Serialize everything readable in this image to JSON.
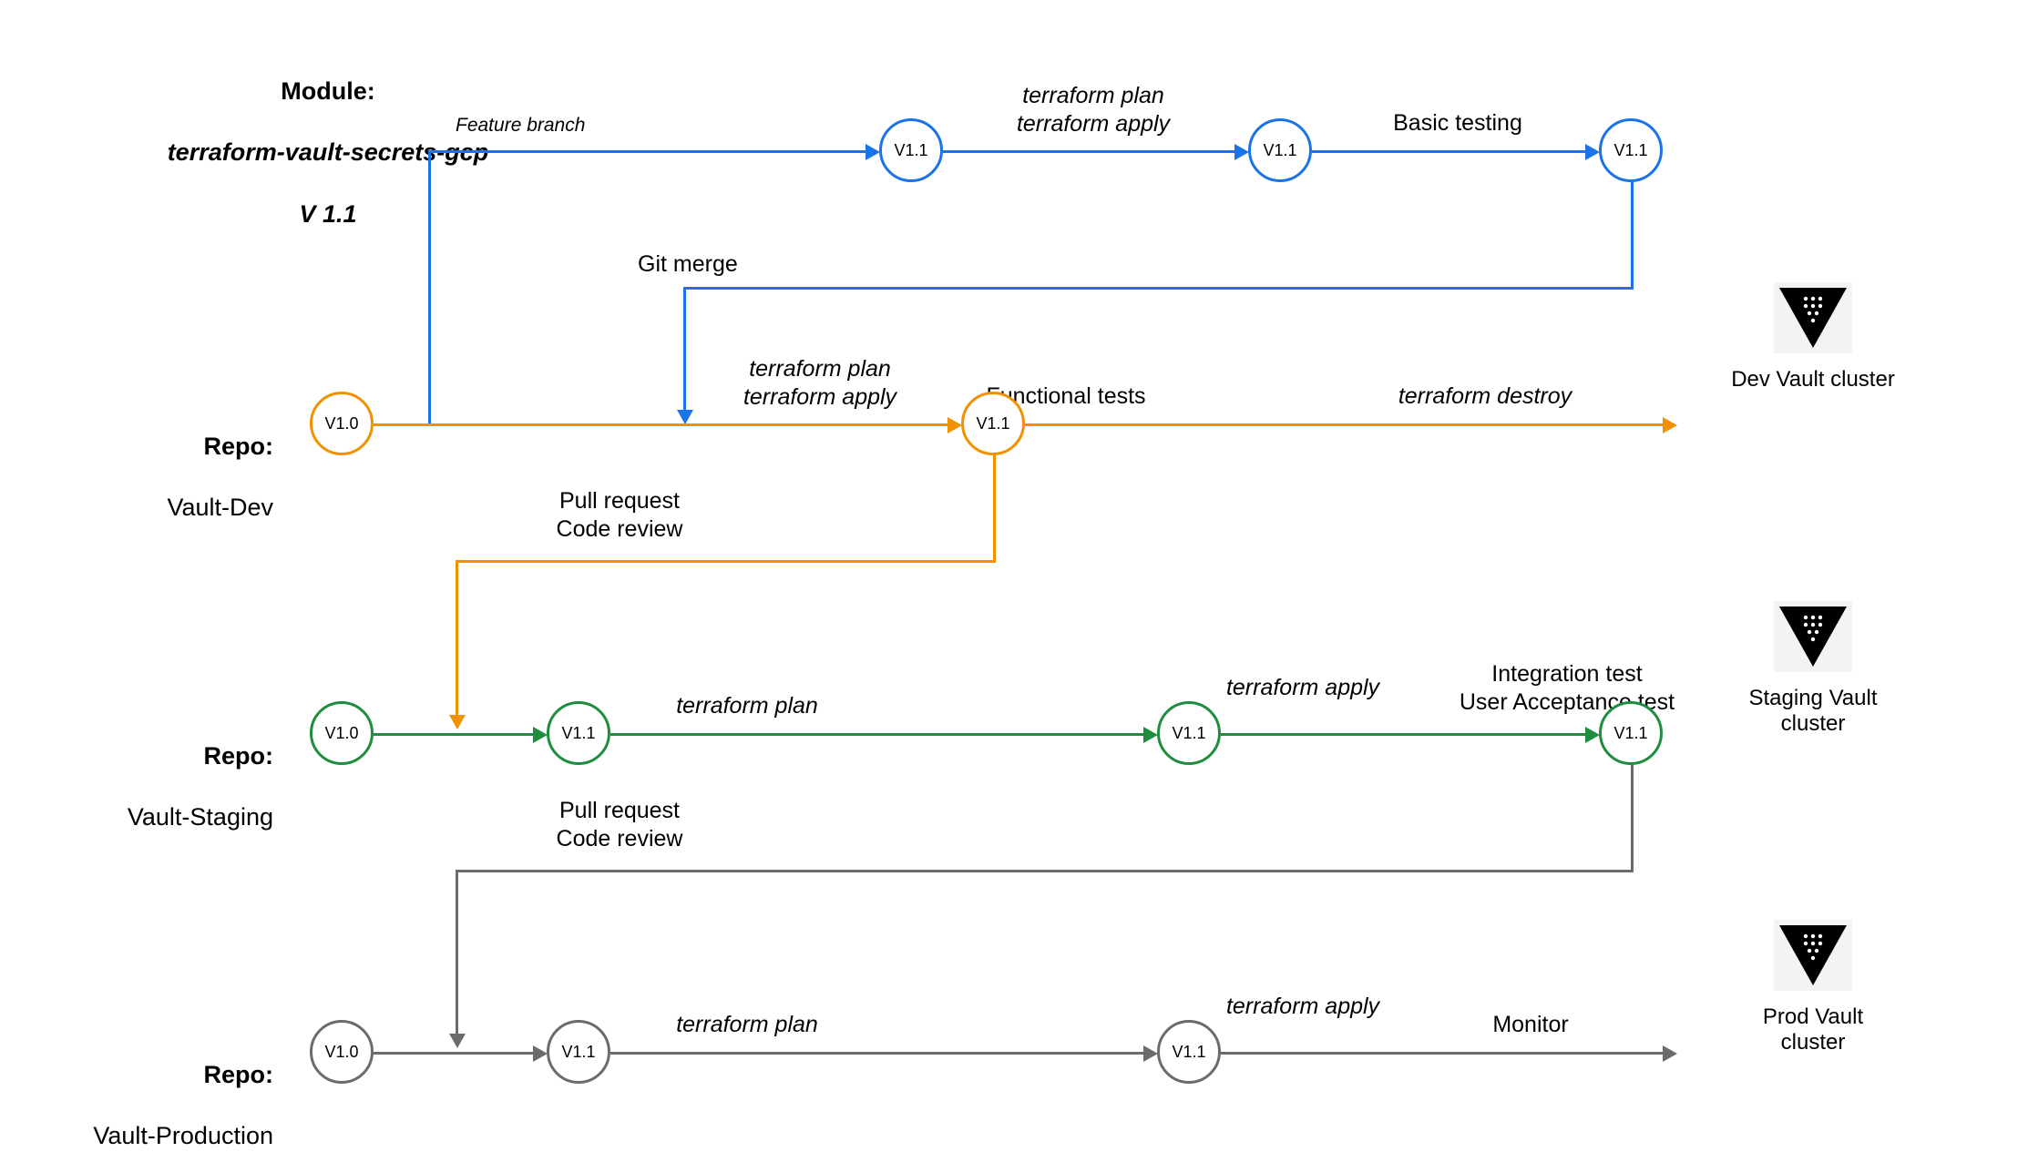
{
  "colors": {
    "blue": "#1a73e8",
    "orange": "#f29100",
    "green": "#1e8e3e",
    "gray": "#6b6b6b"
  },
  "module": {
    "title_line1": "Module:",
    "title_line2": "terraform-vault-secrets-gcp",
    "title_line3": "V 1.1"
  },
  "rows": {
    "dev_title": "Repo:",
    "dev_name": "Vault-Dev",
    "staging_title": "Repo:",
    "staging_name": "Vault-Staging",
    "prod_title": "Repo:",
    "prod_name": "Vault-Production"
  },
  "clusters": {
    "dev": "Dev Vault\ncluster",
    "staging": "Staging Vault\ncluster",
    "prod": "Prod Vault\ncluster"
  },
  "versions": {
    "v10": "V1.0",
    "v11": "V1.1"
  },
  "labels": {
    "feature_branch": "Feature branch",
    "tf_plan_apply": "terraform plan\nterraform apply",
    "basic_testing": "Basic testing",
    "git_merge": "Git merge",
    "functional_tests": "Functional tests",
    "tf_destroy": "terraform destroy",
    "pull_request": "Pull request\nCode review",
    "tf_plan": "terraform plan",
    "tf_apply": "terraform apply",
    "integration_uat": "Integration test\nUser Acceptance test",
    "monitor": "Monitor"
  }
}
